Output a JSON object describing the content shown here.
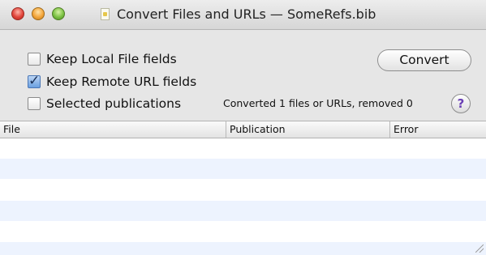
{
  "window": {
    "title": "Convert Files and URLs — SomeRefs.bib",
    "controls": [
      "close-icon",
      "minimize-icon",
      "zoom-icon"
    ],
    "title_icon": "document-icon"
  },
  "options": {
    "keep_local": {
      "label": "Keep Local File fields",
      "checked": false
    },
    "keep_remote": {
      "label": "Keep Remote URL fields",
      "checked": true
    },
    "selected_pubs": {
      "label": "Selected publications",
      "checked": false
    }
  },
  "actions": {
    "convert_label": "Convert",
    "help_label": "?"
  },
  "status": {
    "text": "Converted 1 files or URLs, removed 0"
  },
  "table": {
    "columns": [
      "File",
      "Publication",
      "Error"
    ],
    "rows": []
  },
  "colors": {
    "panel_bg": "#e6e6e6",
    "alt_row": "#edf3fe",
    "help_accent": "#6a3fb5"
  }
}
